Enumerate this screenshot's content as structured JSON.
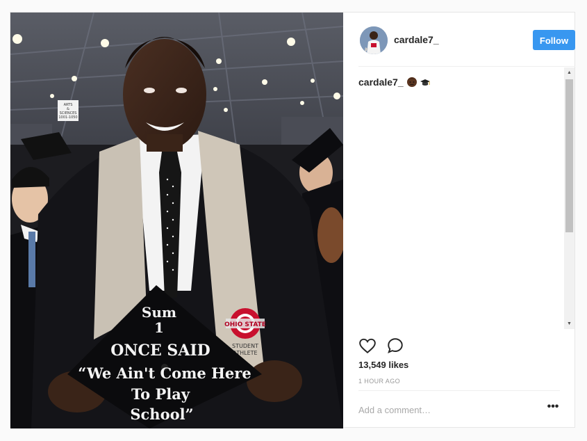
{
  "post": {
    "username": "cardale7_",
    "follow_label": "Follow",
    "caption_user": "cardale7_",
    "caption_emojis": [
      "person-emoji",
      "graduation-cap-emoji"
    ],
    "likes": "13,549 likes",
    "time": "1 HOUR AGO",
    "comment_placeholder": "Add a comment…",
    "more_label": "•••"
  },
  "photo": {
    "cap_text": [
      "Sum",
      "1",
      "ONCE SAID",
      "“We Ain't Come Here",
      "To Play",
      "School”"
    ],
    "sign_text": [
      "ARTS",
      "&",
      "SCIENCES",
      "1001-1050"
    ],
    "badge_text": [
      "OHIO STATE",
      "STUDENT",
      "ATHLETE"
    ]
  },
  "colors": {
    "accent": "#3897f0",
    "text": "#262626",
    "muted": "#999999",
    "border": "#efefef"
  },
  "icons": [
    "heart-icon",
    "comment-icon",
    "scroll-up-icon",
    "scroll-down-icon",
    "more-options-icon"
  ]
}
